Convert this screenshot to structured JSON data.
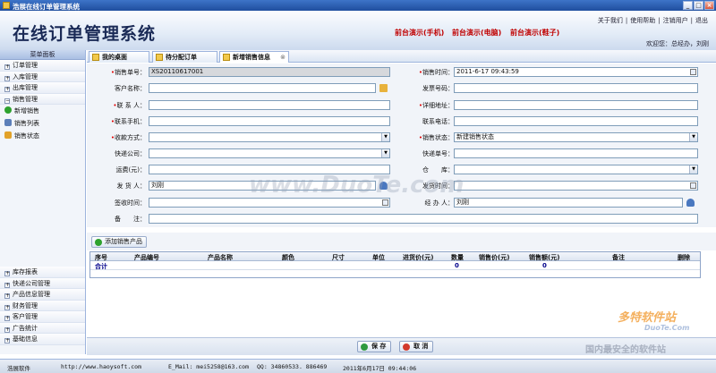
{
  "window": {
    "title": "浩展在线订单管理系统",
    "min": "_",
    "max": "□",
    "close": "×"
  },
  "header": {
    "app_title": "在线订单管理系统",
    "demos": [
      "前台演示(手机)",
      "前台演示(电脑)",
      "前台演示(鞋子)"
    ],
    "links": [
      "关于我们",
      "使用帮助",
      "注销用户",
      "退出"
    ],
    "welcome": "欢迎您：总经办，刘刚"
  },
  "sidebar": {
    "title": "菜单面板",
    "top_items": [
      {
        "label": "订单管理",
        "expanded": false
      },
      {
        "label": "入库管理",
        "expanded": false
      },
      {
        "label": "出库管理",
        "expanded": false
      },
      {
        "label": "销售管理",
        "expanded": true
      }
    ],
    "sub_items": [
      {
        "label": "新增销售",
        "icon": "plus-circle-icon",
        "color": "#2ea22e"
      },
      {
        "label": "销售列表",
        "icon": "list-icon",
        "color": "#5c7fb9"
      },
      {
        "label": "销售状态",
        "icon": "status-icon",
        "color": "#e2a229"
      }
    ],
    "bottom_items": [
      "库存报表",
      "快递公司管理",
      "产品信息管理",
      "财务管理",
      "客户管理",
      "广告统计",
      "基础信息"
    ]
  },
  "tabs": [
    {
      "label": "我的桌面",
      "active": false
    },
    {
      "label": "待分配订单",
      "active": false
    },
    {
      "label": "新增销售信息",
      "active": true
    }
  ],
  "form": {
    "sale_no_label": "销售单号：",
    "sale_no": "XS20110617001",
    "sale_time_label": "销售时间：",
    "sale_time": "2011-6-17 09:43:59",
    "customer_label": "客户名称：",
    "customer": "",
    "invoice_label": "发票号码：",
    "invoice": "",
    "contact_label": "联 系 人：",
    "contact": "",
    "address_label": "详细地址：",
    "address": "",
    "mobile_label": "联系手机：",
    "mobile": "",
    "phone_label": "联系电话：",
    "phone": "",
    "payment_label": "收款方式：",
    "payment": "",
    "status_label": "销售状态：",
    "status": "新建销售状态",
    "courier_label": "快递公司：",
    "courier": "",
    "tracking_label": "快递单号：",
    "tracking": "",
    "freight_label": "运费(元)：",
    "freight": "",
    "warehouse_label": "仓　　库：",
    "warehouse": "",
    "shipper_label": "发 货 人：",
    "shipper": "刘刚",
    "ship_time_label": "发货时间：",
    "ship_time": "",
    "sign_time_label": "签收时间：",
    "sign_time": "",
    "handler_label": "经 办 人：",
    "handler": "刘刚",
    "remark_label": "备　　注：",
    "remark": ""
  },
  "add_product_label": "添加销售产品",
  "grid": {
    "headers": [
      "序号",
      "产品编号",
      "产品名称",
      "颜色",
      "尺寸",
      "单位",
      "进货价(元)",
      "数量",
      "销售价(元)",
      "销售额(元)",
      "备注",
      "删除"
    ],
    "summary_label": "合计",
    "summary_qty": "0",
    "summary_amount": "0"
  },
  "buttons": {
    "save": "保 存",
    "cancel": "取 消"
  },
  "status_bar": {
    "company": "浩展软件",
    "url": "http://www.haoysoft.com",
    "email": "E_Mail: mei5258@163.com",
    "qq": "QQ: 34860533. 886469",
    "datetime": "2011年6月17日 09:44:06"
  },
  "watermark": {
    "main": "www.DuoTe.com",
    "brand": "多特软件站",
    "brand_url": "DuoTe.Com",
    "slogan": "国内最安全的软件站"
  }
}
